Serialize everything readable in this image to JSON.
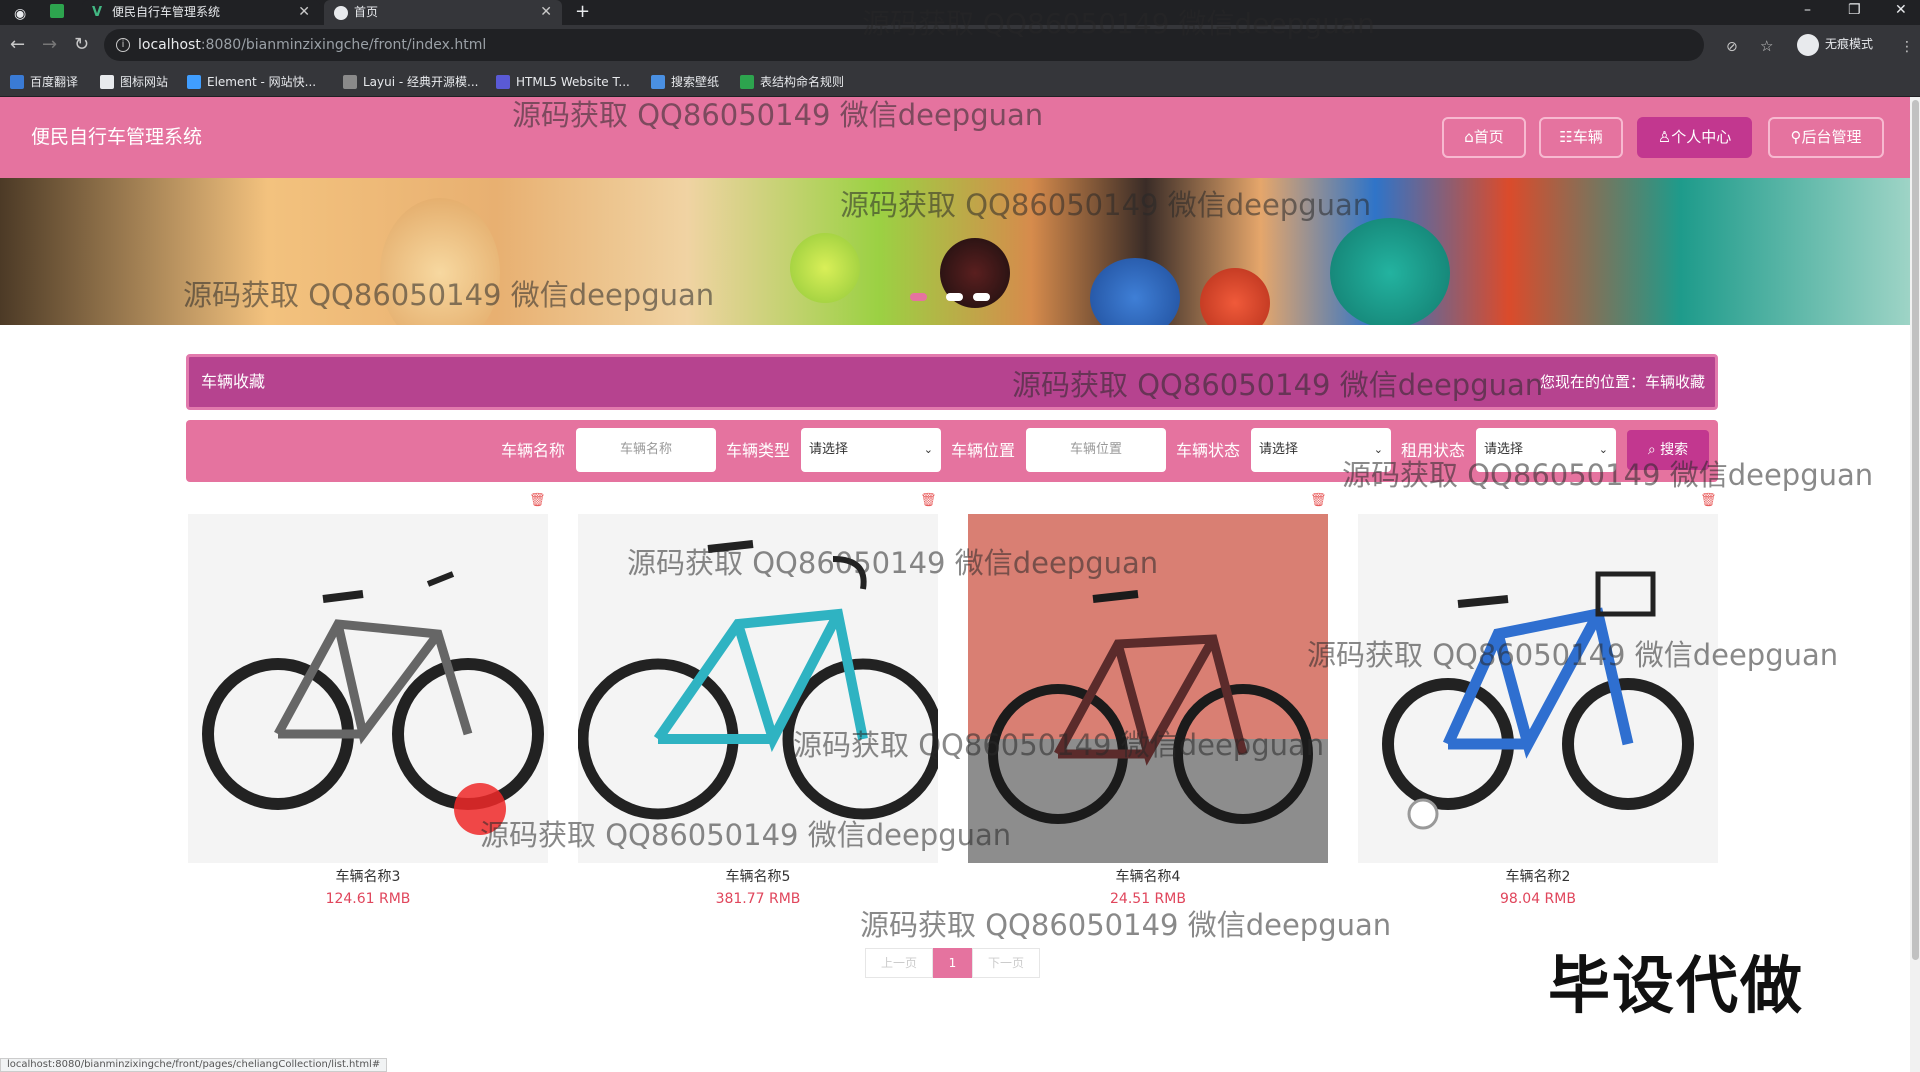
{
  "browser": {
    "tabs": [
      {
        "title": "便民自行车管理系统",
        "active": false
      },
      {
        "title": "首页",
        "active": true
      }
    ],
    "url_host": "localhost",
    "url_rest": ":8080/bianminzixingche/front/index.html",
    "incognito_label": "无痕模式",
    "bookmarks": [
      "百度翻译",
      "图标网站",
      "Element - 网站快...",
      "Layui - 经典开源模...",
      "HTML5 Website T...",
      "搜索壁纸",
      "表结构命名规则"
    ],
    "status_url": "localhost:8080/bianminzixingche/front/pages/cheliangCollection/list.html#"
  },
  "header": {
    "site_title": "便民自行车管理系统",
    "nav": [
      {
        "label": "首页",
        "icon": "home-icon"
      },
      {
        "label": "车辆",
        "icon": "list-icon"
      },
      {
        "label": "个人中心",
        "icon": "user-icon"
      },
      {
        "label": "后台管理",
        "icon": "link-icon"
      }
    ],
    "active_nav": "个人中心"
  },
  "banner": {
    "slide_count": 3,
    "active_slide": 1
  },
  "breadcrumb": {
    "title": "车辆收藏",
    "location": "您现在的位置：车辆收藏"
  },
  "search": {
    "fields": [
      {
        "label": "车辆名称",
        "placeholder": "车辆名称"
      },
      {
        "label": "车辆类型",
        "value": "请选择"
      },
      {
        "label": "车辆位置",
        "placeholder": "车辆位置"
      },
      {
        "label": "车辆状态",
        "value": "请选择"
      },
      {
        "label": "租用状态",
        "value": "请选择"
      }
    ],
    "button_label": "搜索"
  },
  "items": [
    {
      "name": "车辆名称3",
      "price": "124.61 RMB"
    },
    {
      "name": "车辆名称5",
      "price": "381.77 RMB"
    },
    {
      "name": "车辆名称4",
      "price": "24.51 RMB"
    },
    {
      "name": "车辆名称2",
      "price": "98.04 RMB"
    }
  ],
  "pagination": {
    "prev": "上一页",
    "current": "1",
    "next": "下一页"
  },
  "overlay": {
    "stamp": "毕设代做",
    "watermark": "源码获取 QQ86050149 微信deepguan"
  },
  "colors": {
    "accent": "#e5739f",
    "accent_dark": "#b6438f",
    "price": "#e0465c"
  }
}
